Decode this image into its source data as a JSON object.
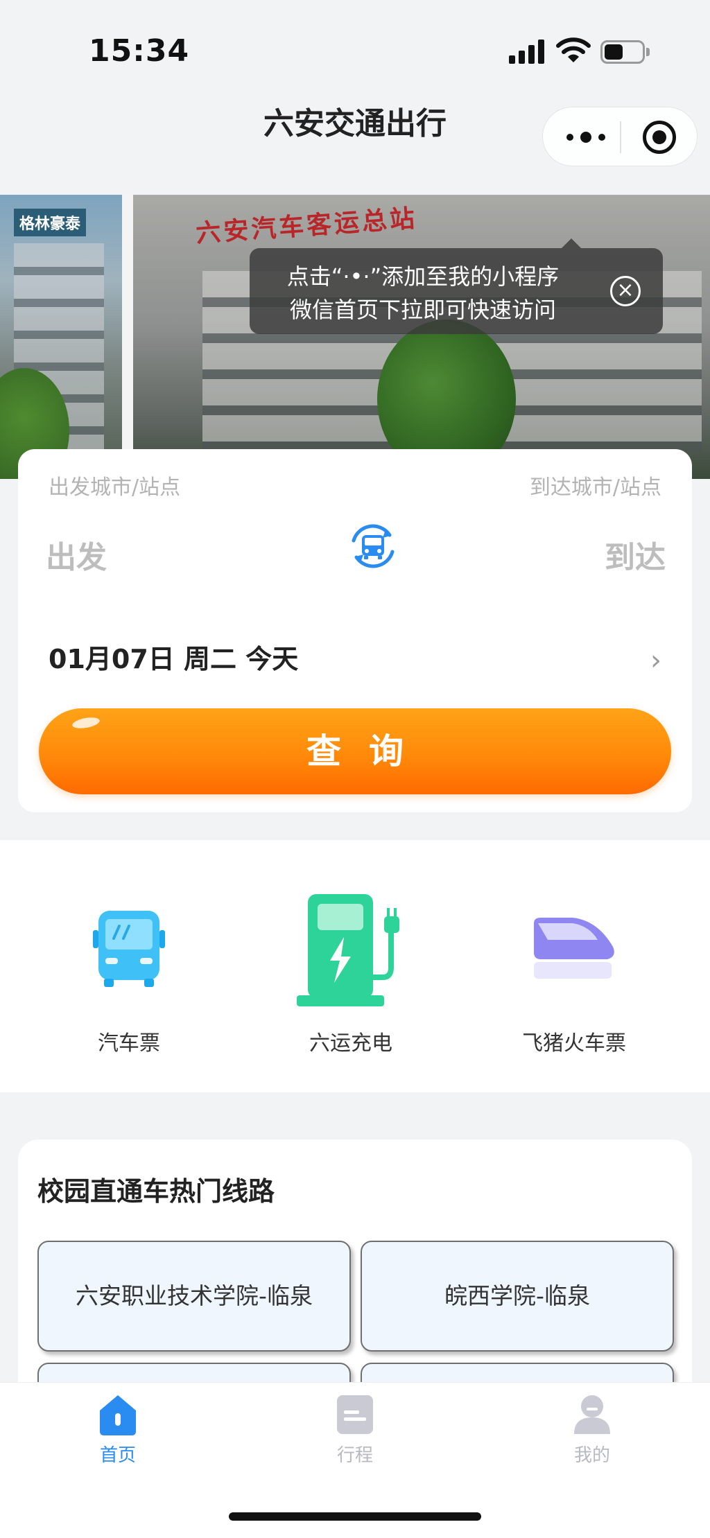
{
  "status_bar": {
    "time": "15:34"
  },
  "nav": {
    "title": "六安交通出行"
  },
  "banner": {
    "sign_text": "六安汽车客运总站",
    "left_sign_text": "格林豪泰",
    "tooltip_line1": "点击“·•·”添加至我的小程序",
    "tooltip_line2": "微信首页下拉即可快速访问",
    "close_glyph": "×",
    "slide_count": 2,
    "active_slide": 2
  },
  "search": {
    "from_label": "出发城市/站点",
    "to_label": "到达城市/站点",
    "from_value": "出发",
    "to_value": "到达",
    "date": "01月07日 周二 今天",
    "chevron": "›",
    "query_button": "查询"
  },
  "services": [
    {
      "label": "汽车票",
      "icon": "bus-icon"
    },
    {
      "label": "六运充电",
      "icon": "charging-station-icon"
    },
    {
      "label": "飞猪火车票",
      "icon": "train-icon"
    }
  ],
  "routes": {
    "title": "校园直通车热门线路",
    "items": [
      {
        "label": "六安职业技术学院-临泉"
      },
      {
        "label": "皖西学院-临泉"
      },
      {
        "label": ""
      },
      {
        "label": ""
      }
    ]
  },
  "tabbar": {
    "items": [
      {
        "label": "首页",
        "icon": "home-icon",
        "active": true
      },
      {
        "label": "行程",
        "icon": "trip-icon",
        "active": false
      },
      {
        "label": "我的",
        "icon": "profile-icon",
        "active": false
      }
    ]
  },
  "colors": {
    "accent_blue": "#2a8cf0",
    "query_orange": "#ff8a0a",
    "charge_green": "#2ed39a",
    "train_purple": "#8f86f2"
  }
}
